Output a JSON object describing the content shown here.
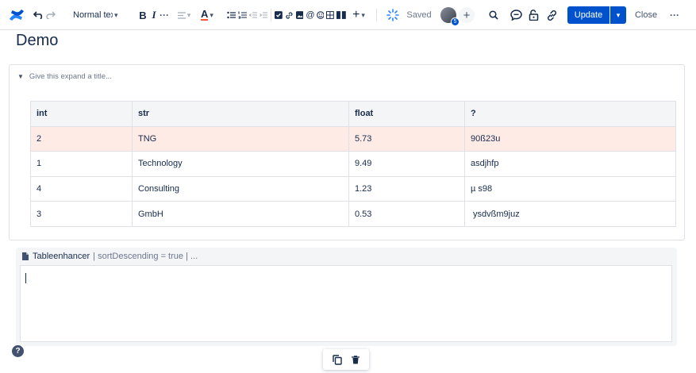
{
  "toolbar": {
    "text_style": "Normal text",
    "bold": "B",
    "italic": "I",
    "more": "···",
    "saved": "Saved",
    "update": "Update",
    "close": "Close",
    "overflow": "···",
    "collaborator_count": "5",
    "insert": "+",
    "colors": {
      "accent": "#0052cc",
      "text": "#172b4d"
    }
  },
  "page": {
    "title": "Demo"
  },
  "expand": {
    "placeholder": "Give this expand a title..."
  },
  "table": {
    "headers": [
      "int",
      "str",
      "float",
      "?"
    ],
    "rows": [
      [
        "2",
        "TNG",
        "5.73",
        "90ß23u"
      ],
      [
        "1",
        "Technology",
        "9.49",
        "asdjhfp"
      ],
      [
        "4",
        "Consulting",
        "1.23",
        "µ s98"
      ],
      [
        "3",
        "GmbH",
        "0.53",
        " ysdvßm9juz"
      ]
    ],
    "highlight_color": "#ffebe6"
  },
  "macro": {
    "name": "Tableenhancer",
    "params": "| sortDescending = true | ..."
  },
  "help": "?"
}
